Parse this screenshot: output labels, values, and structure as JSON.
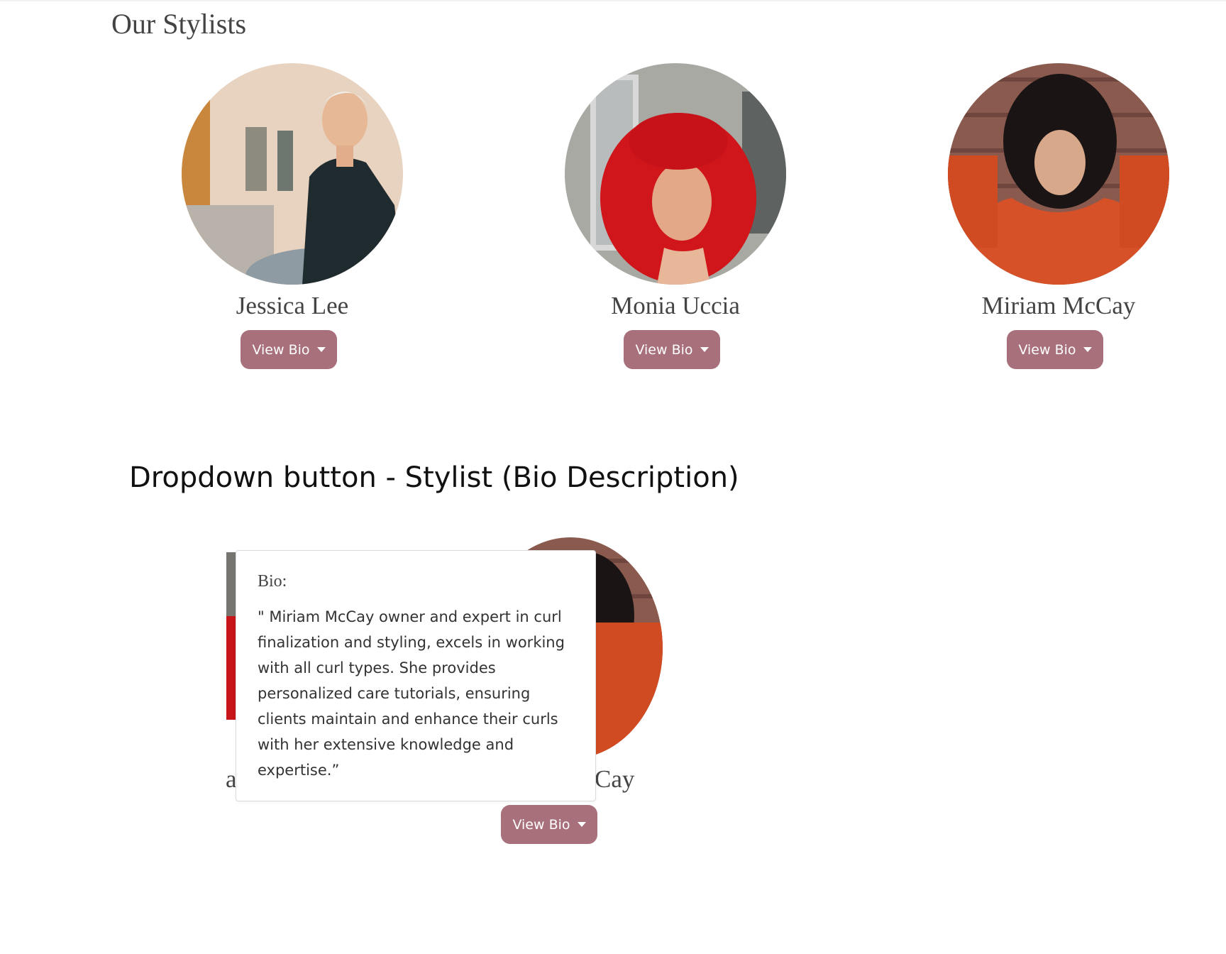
{
  "page": {
    "title": "Our Stylists"
  },
  "stylists": [
    {
      "name": "Jessica Lee",
      "button_label": "View Bio"
    },
    {
      "name": "Monia Uccia",
      "button_label": "View Bio"
    },
    {
      "name": "Miriam McCay",
      "button_label": "View Bio"
    }
  ],
  "demo": {
    "heading": "Dropdown button - Stylist (Bio Description)",
    "name_fragment_left": "a",
    "name_fragment_right": "Cay",
    "button_label": "View Bio",
    "dropdown": {
      "label": "Bio:",
      "text": "\" Miriam McCay owner and expert in curl finalization and styling, excels in working with all curl types. She provides personalized care tutorials, ensuring clients maintain and enhance their curls with her extensive knowledge and expertise.”"
    }
  },
  "colors": {
    "button": "#a8707b",
    "heading": "#444444"
  },
  "icons": [
    "caret-down-icon"
  ]
}
